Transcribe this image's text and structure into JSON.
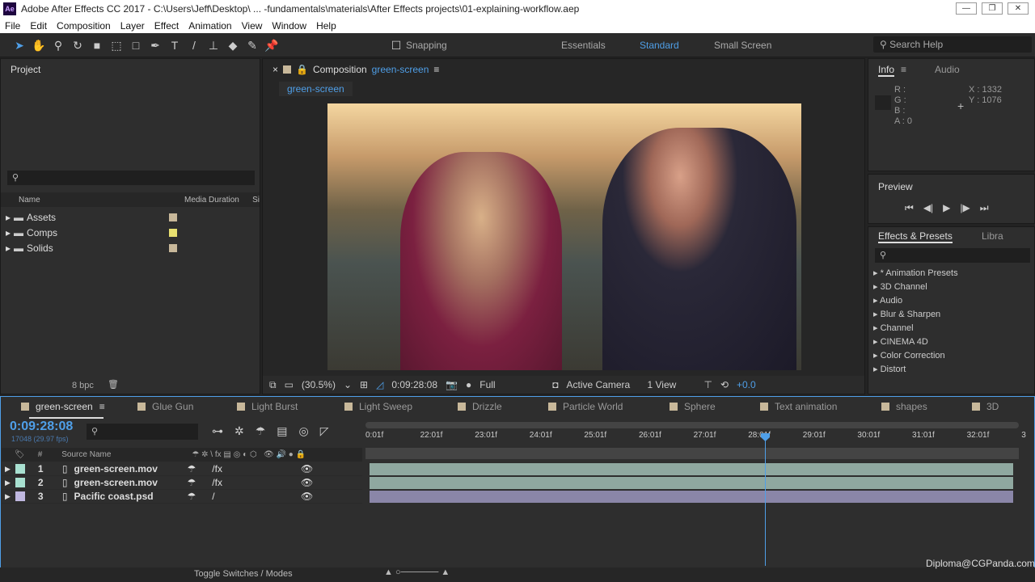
{
  "app": {
    "icon": "Ae",
    "title": "Adobe After Effects CC 2017 - C:\\Users\\Jeff\\Desktop\\ ... -fundamentals\\materials\\After Effects projects\\01-explaining-workflow.aep"
  },
  "menu": [
    "File",
    "Edit",
    "Composition",
    "Layer",
    "Effect",
    "Animation",
    "View",
    "Window",
    "Help"
  ],
  "toolbar": {
    "snapping": "Snapping",
    "workspaces": [
      "Essentials",
      "Standard",
      "Small Screen"
    ],
    "search": "Search Help"
  },
  "project": {
    "title": "Project",
    "columns": [
      "Name",
      "Media Duration",
      "Si"
    ],
    "items": [
      {
        "name": "Assets",
        "color": "#c8b89a"
      },
      {
        "name": "Comps",
        "color": "#e8e070"
      },
      {
        "name": "Solids",
        "color": "#c8b89a"
      }
    ],
    "bpc": "8 bpc"
  },
  "composition": {
    "title": "Composition",
    "name": "green-screen",
    "tab": "green-screen",
    "zoom": "(30.5%)",
    "timecode": "0:09:28:08",
    "resolution": "Full",
    "camera": "Active Camera",
    "view": "1 View",
    "exposure": "+0.0"
  },
  "info": {
    "tabs": [
      "Info",
      "Audio"
    ],
    "r": "R :",
    "g": "G :",
    "b": "B :",
    "a": "A : 0",
    "x": "X : 1332",
    "y": "Y : 1076"
  },
  "preview": {
    "title": "Preview"
  },
  "effects": {
    "tabs": [
      "Effects & Presets",
      "Libra"
    ],
    "items": [
      "* Animation Presets",
      "3D Channel",
      "Audio",
      "Blur & Sharpen",
      "Channel",
      "CINEMA 4D",
      "Color Correction",
      "Distort"
    ]
  },
  "timeline": {
    "tabs": [
      {
        "label": "green-screen",
        "color": "#c8b89a"
      },
      {
        "label": "Glue Gun",
        "color": "#c8b89a"
      },
      {
        "label": "Light Burst",
        "color": "#c8b89a"
      },
      {
        "label": "Light Sweep",
        "color": "#c8b89a"
      },
      {
        "label": "Drizzle",
        "color": "#c8b89a"
      },
      {
        "label": "Particle World",
        "color": "#c8b89a"
      },
      {
        "label": "Sphere",
        "color": "#c8b89a"
      },
      {
        "label": "Text animation",
        "color": "#c8b89a"
      },
      {
        "label": "shapes",
        "color": "#c8b89a"
      },
      {
        "label": "3D",
        "color": "#c8b89a"
      }
    ],
    "timecode": "0:09:28:08",
    "frames": "17048 (29.97 fps)",
    "col_num": "#",
    "col_source": "Source Name",
    "layers": [
      {
        "num": "1",
        "name": "green-screen.mov",
        "color": "#a8e0d0",
        "bar": "#8fa8a0"
      },
      {
        "num": "2",
        "name": "green-screen.mov",
        "color": "#a8e0d0",
        "bar": "#8fa8a0"
      },
      {
        "num": "3",
        "name": "Pacific coast.psd",
        "color": "#c0b8e0",
        "bar": "#8a86a8"
      }
    ],
    "ruler": [
      "0:01f",
      "22:01f",
      "23:01f",
      "24:01f",
      "25:01f",
      "26:01f",
      "27:01f",
      "28:01f",
      "29:01f",
      "30:01f",
      "31:01f",
      "32:01f",
      "3"
    ],
    "toggle": "Toggle Switches / Modes",
    "accent": "#4f9fe8"
  },
  "watermark": "Diploma@CGPanda.com"
}
